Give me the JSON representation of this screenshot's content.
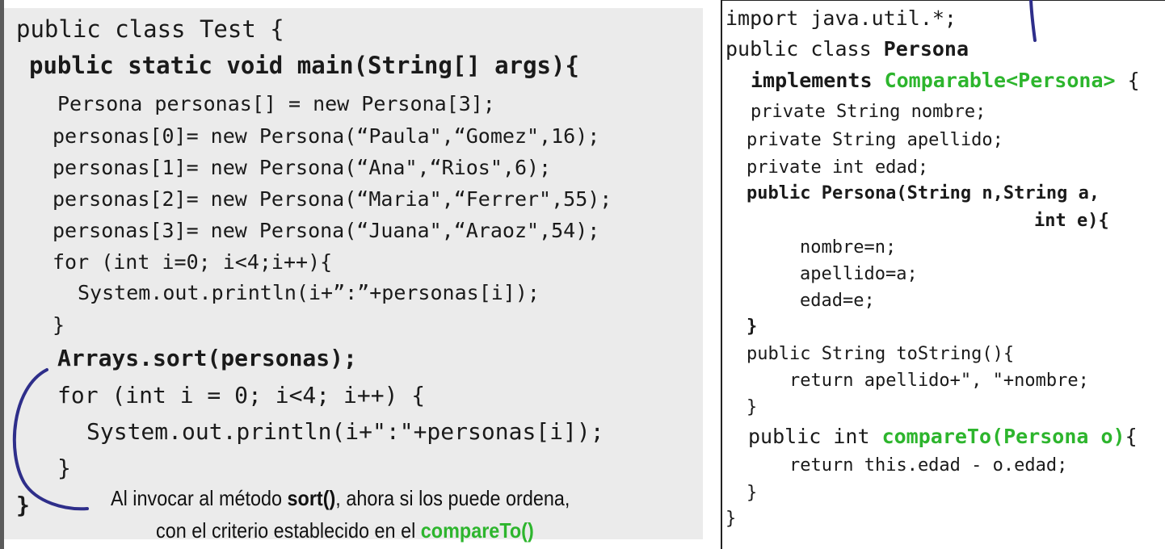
{
  "left_code": {
    "l1": "public class Test {",
    "l2": "public static void main(String[] args){",
    "l3": "Persona personas[] = new Persona[3];",
    "l4": "personas[0]= new Persona(“Paula\",“Gomez\",16);",
    "l5": "personas[1]= new Persona(“Ana\",“Rios\",6);",
    "l6": "personas[2]= new Persona(“Maria\",“Ferrer\",55);",
    "l7": "personas[3]= new Persona(“Juana\",“Araoz\",54);",
    "l8": "for (int i=0; i<4;i++){",
    "l9": "System.out.println(i+”:”+personas[i]);",
    "l10": "}",
    "l11": "Arrays.sort(personas);",
    "l12": "for (int i = 0; i<4; i++) {",
    "l13": "System.out.println(i+\":\"+personas[i]);",
    "l14": "}",
    "l15": "}"
  },
  "note": {
    "line1_pre": "Al invocar al método ",
    "line1_bold": "sort()",
    "line1_post": ", ahora si los puede ordena,",
    "line2_pre": "con el criterio establecido en el ",
    "line2_green": "compareTo()"
  },
  "right_code": {
    "r1": "import java.util.*;",
    "r2a": "public class ",
    "r2b": "Persona",
    "r3a": "implements ",
    "r3b": "Comparable<Persona>",
    "r3c": " {",
    "r4": "private String nombre;",
    "r5": "private String apellido;",
    "r6": "private int edad;",
    "r7": "public Persona(String n,String a,",
    "r8": "int e){",
    "r9": "nombre=n;",
    "r10": "apellido=a;",
    "r11": "edad=e;",
    "r12": "}",
    "r13": "public String toString(){",
    "r14": "return apellido+\", \"+nombre;",
    "r15": "}",
    "r16a": "public int ",
    "r16b": "compareTo(Persona o)",
    "r16c": "{",
    "r17": "return this.edad - o.edad;",
    "r18": "}",
    "r19": "}"
  },
  "colors": {
    "keyword_green": "#2db52d",
    "annotation_blue": "#2e2e8a",
    "panel_gray": "#ebebeb"
  }
}
